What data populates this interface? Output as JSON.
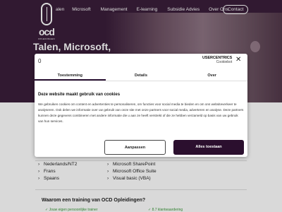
{
  "logo": {
    "word": "ocd",
    "sub": "OPLEIDINGEN"
  },
  "nav": {
    "items": [
      "alen",
      "Microsoft",
      "Management",
      "E-learning",
      "Subsidie Advies",
      "Over Ons"
    ],
    "contact": "Contact"
  },
  "hero": {
    "title": "Talen, Microsoft,"
  },
  "consent": {
    "top_glyph": "0",
    "brand": "USERCENTRICS",
    "brand_sub": "Cookiebot",
    "close": "✕",
    "tabs": [
      "Toestemming",
      "Details",
      "Over"
    ],
    "heading": "Deze website maakt gebruik van cookies",
    "body": "We gebruiken cookies om content en advertenties te personaliseren, om functies voor social media te bieden en om ons websiteverkeer te analyseren. Ook delen we informatie over uw gebruik van onze site met onze partners voor social media, adverteren en analyse. Deze partners kunnen deze gegevens combineren met andere informatie die u aan ze heeft verstrekt of die ze hebben verzameld op basis van uw gebruik van hun services.",
    "btn_adjust": "Aanpassen",
    "btn_accept": "Alles toestaan"
  },
  "courses": {
    "left": [
      "Nederlands/NT2",
      "Frans",
      "Spaans"
    ],
    "right": [
      "Microsoft SharePoint",
      "Microsoft Office Suite",
      "Visual basic (VBA)"
    ]
  },
  "why": {
    "title": "Waarom een training van OCD Opleidingen?",
    "bullet_left": "✓ Jouw eigen persoonlijke trainer",
    "bullet_right": "✓ 8.7 klantwaardering"
  }
}
